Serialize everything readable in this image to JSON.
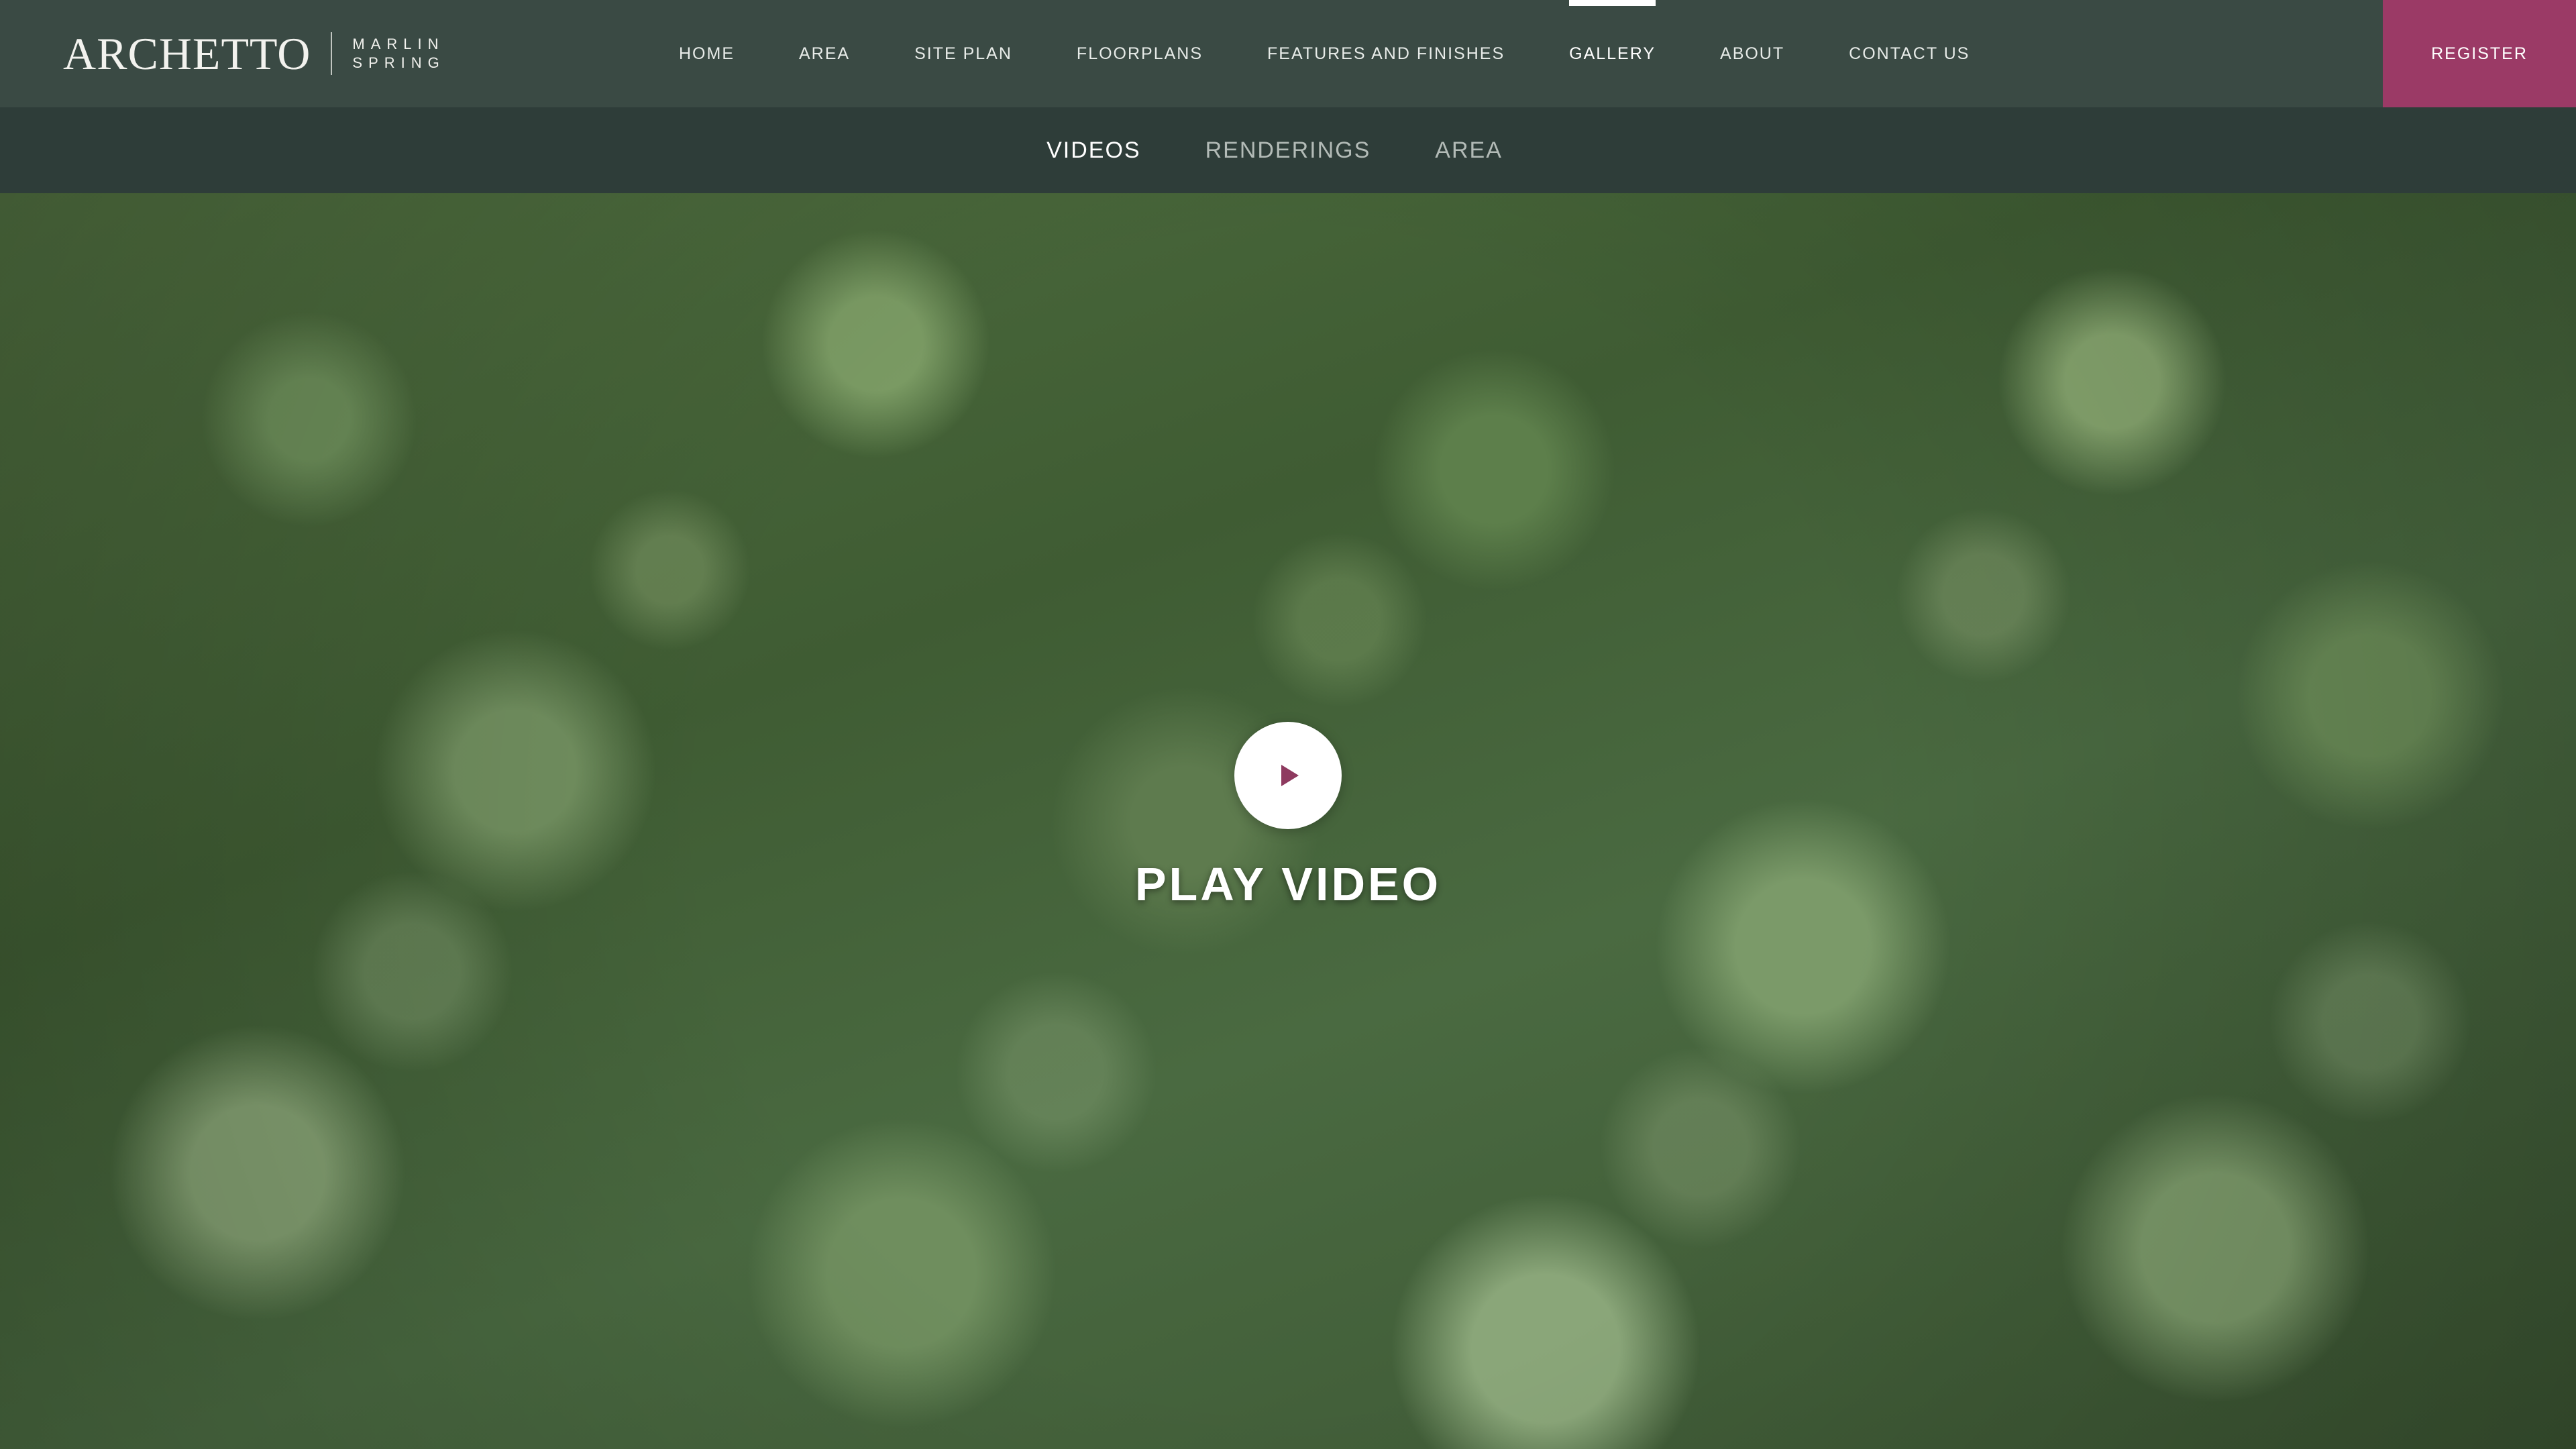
{
  "brand": {
    "logo_word": "ARCHETTO",
    "logo_sub_line1": "MARLIN",
    "logo_sub_line2": "SPRING"
  },
  "nav": {
    "items": [
      {
        "label": "HOME"
      },
      {
        "label": "AREA"
      },
      {
        "label": "SITE PLAN"
      },
      {
        "label": "FLOORPLANS"
      },
      {
        "label": "FEATURES AND FINISHES"
      },
      {
        "label": "GALLERY",
        "active": true
      },
      {
        "label": "ABOUT"
      },
      {
        "label": "CONTACT US"
      }
    ],
    "register_label": "REGISTER"
  },
  "subnav": {
    "items": [
      {
        "label": "VIDEOS",
        "active": true
      },
      {
        "label": "RENDERINGS"
      },
      {
        "label": "AREA"
      }
    ]
  },
  "hero": {
    "play_label": "PLAY VIDEO",
    "icon": "play-icon"
  },
  "colors": {
    "topbar_bg": "#3a4a44",
    "subbar_bg": "#2e3d39",
    "register_bg": "#9b3a66",
    "play_icon": "#8e3a5f"
  }
}
